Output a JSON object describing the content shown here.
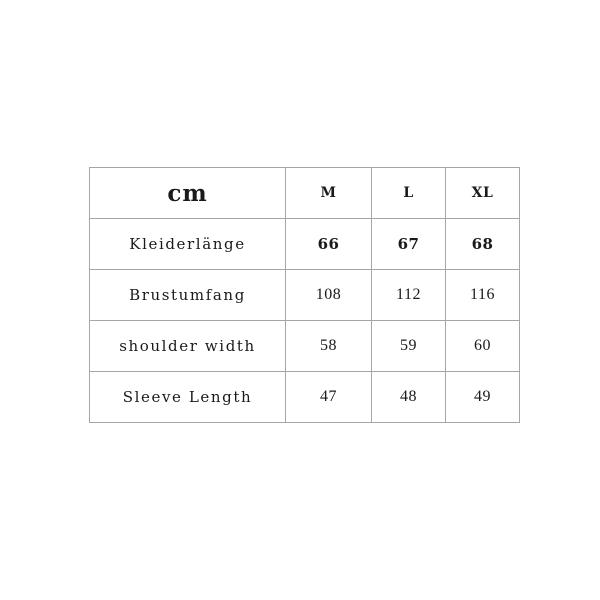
{
  "background_color": "#ffffff",
  "table": {
    "border_color": "#a6a6a6",
    "text_color": "#1a1a1a",
    "unit_label": "cm",
    "size_columns": [
      "M",
      "L",
      "XL"
    ],
    "rows": [
      {
        "label": "Kleiderlänge",
        "values": [
          "66",
          "67",
          "68"
        ],
        "bold": true
      },
      {
        "label": "Brustumfang",
        "values": [
          "108",
          "112",
          "116"
        ],
        "bold": false
      },
      {
        "label": "shoulder width",
        "values": [
          "58",
          "59",
          "60"
        ],
        "bold": false
      },
      {
        "label": "Sleeve Length",
        "values": [
          "47",
          "48",
          "49"
        ],
        "bold": false
      }
    ]
  }
}
